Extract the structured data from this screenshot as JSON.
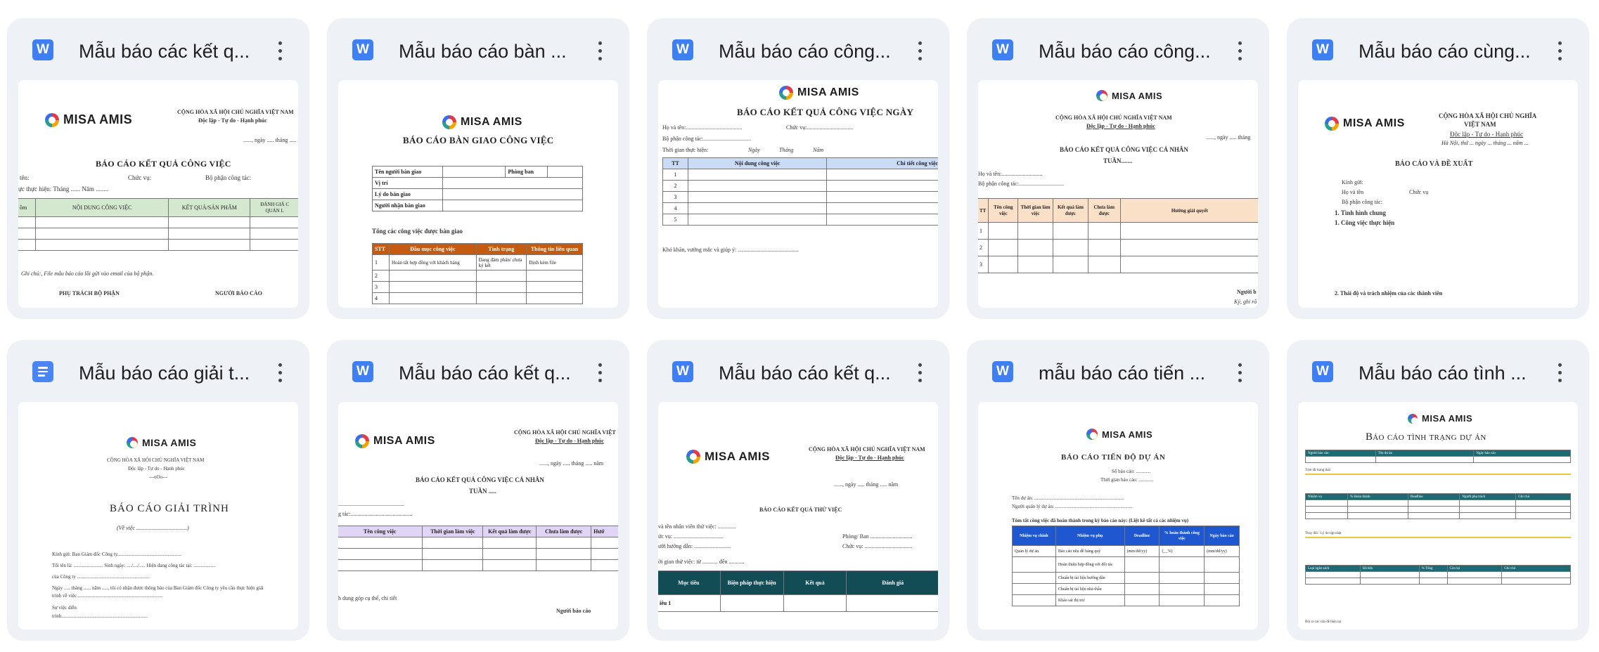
{
  "cards": [
    {
      "title": "Mẫu báo các kết q...",
      "icon": "word-icon",
      "thumb": {
        "logo": "MISA AMIS",
        "header_right": [
          "CỘNG HÒA XÃ HỘI CHỦ NGHĨA VIỆT NAM",
          "Độc lập - Tự do - Hạnh phúc",
          "......, ngày ..... tháng ..... nă"
        ],
        "heading": "BÁO CÁO KẾT QUẢ CÔNG VIỆC",
        "fields": [
          "tên:",
          "Chức vụ:",
          "Bộ phận công tác:",
          "ực thực hiện: Tháng ...... Năm ........"
        ],
        "columns": [
          "ồm",
          "NỘI DUNG CÔNG VIỆC",
          "KẾT QUẢ/SẢN PHẨM",
          "ĐÁNH GIÁ C QUẢN L"
        ],
        "note": "Ghi chú:, File mẫu báo cáo lồi gửi vào email của bộ phận.",
        "footer": [
          "PHỤ TRÁCH BỘ PHẬN",
          "NGƯỜI BÁO CÁO"
        ]
      }
    },
    {
      "title": "Mẫu báo cáo bàn ...",
      "icon": "word-icon",
      "thumb": {
        "logo": "MISA AMIS",
        "heading": "BÁO CÁO BÀN GIAO CÔNG VIỆC",
        "form": [
          "Tên người bàn giao",
          "Phòng ban",
          "Vị trí",
          "Lý do bàn giao",
          "Người nhận bàn giao"
        ],
        "subheading": "Tổng các công việc được bàn giao",
        "columns": [
          "STT",
          "Đầu mục công việc",
          "Tình trạng",
          "Thông tin liên quan"
        ],
        "row1": [
          "1",
          "Hoàn tất hợp đồng với khách hàng",
          "Đang đàm phán/ chưa ký kết",
          "Định kèm file"
        ],
        "row_numbers": [
          "2",
          "3",
          "4"
        ]
      }
    },
    {
      "title": "Mẫu báo cáo công...",
      "icon": "word-icon",
      "thumb": {
        "logo": "MISA AMIS",
        "heading": "BÁO CÁO KẾT QUẢ CÔNG VIỆC NGÀY",
        "fields": [
          "Họ và tên:........................................",
          "Chức vụ:.................................",
          "Bộ phận công tác:..................................",
          "Thời gian thực hiện:",
          "Ngày",
          "Tháng",
          "Năm"
        ],
        "columns": [
          "TT",
          "Nội dung công việc",
          "Chi tiết công việc"
        ],
        "rows": [
          "1",
          "2",
          "3",
          "4",
          "5"
        ],
        "note": "Khó khăn, vướng mắc và giúp ý: ..........................................."
      }
    },
    {
      "title": "Mẫu báo cáo công...",
      "icon": "word-icon",
      "thumb": {
        "logo": "MISA AMIS",
        "header": [
          "CỘNG HÒA XÃ HỘI CHỦ NGHĨA VIỆT NAM",
          "Độc lập - Tự do - Hạnh phúc"
        ],
        "date": "......, ngày ..... tháng",
        "heading": "BÁO CÁO KẾT QUẢ CÔNG VIỆC CÁ NHÂN",
        "sub": "TUẦN.......",
        "fields": [
          "Họ và tên:.............................",
          "Bộ phận công tác:................................"
        ],
        "columns": [
          "TT",
          "Tên công việc",
          "Thời gian làm việc",
          "Kết quả làm được",
          "Chưa làm được",
          "Hướng giải quyết"
        ],
        "rows": [
          "1",
          "2",
          "3"
        ],
        "footer": [
          "Người b",
          "Ký, ghi rõ"
        ]
      }
    },
    {
      "title": "Mẫu báo cáo cùng...",
      "icon": "word-icon",
      "thumb": {
        "logo": "MISA AMIS",
        "header_right": [
          "CỘNG HÒA XÃ HỘI CHỦ NGHĨA",
          "VIỆT NAM",
          "Độc lập - Tự do - Hạnh phúc",
          "Hà Nội, thứ ... ngày ... tháng ... năm ..."
        ],
        "heading": "BÁO CÁO VÀ ĐỀ XUẤT",
        "fields": [
          "Kính gửi:",
          "Họ và tên",
          "Chức vụ",
          "Bộ phận công tác:"
        ],
        "items": [
          "1. Tình hình chung",
          "1. Công việc thực hiện",
          "2. Thái độ và trách nhiệm của các thành viên"
        ]
      }
    },
    {
      "title": "Mẫu báo cáo giải t...",
      "icon": "docs-icon",
      "thumb": {
        "logo": "MISA AMIS",
        "header": [
          "CỘNG HÒA XÃ HỘI CHỦ NGHĨA VIỆT NAM",
          "Độc lập - Tự do - Hạnh phúc",
          "---oOo---"
        ],
        "heading": "BÁO CÁO GIẢI TRÌNH",
        "sub": "(Về việc ....................................)",
        "lines": [
          "Kính gửi: Ban Giám đốc Công ty....................................................",
          "Tôi tên là: ........................ Sinh ngày: ..../..../..... Hiện đang công tác tại: ..................",
          "của Công ty ...........................................................",
          "Ngày ..... tháng ...... năm ...... tôi có nhận được thông báo của Ban Giám đốc Công ty yêu cầu thực hiện giải",
          "trình về việc......................................................................",
          "Sự việc diễn",
          "trình......................................................................"
        ]
      }
    },
    {
      "title": "Mẫu báo cáo kết q...",
      "icon": "word-icon",
      "thumb": {
        "logo": "MISA AMIS",
        "header_right": [
          "CỘNG HÒA XÃ HỘI CHỦ NGHĨA VIỆT",
          "Độc lập - Tự do - Hạnh phúc"
        ],
        "date": "......, ngày ..... tháng ..... năm",
        "heading": "BÁO CÁO KẾT QUẢ CÔNG VIỆC CÁ NHÂN",
        "sub": "TUẦN .....",
        "fields": [
          "...............................................",
          "g tác:............................................"
        ],
        "columns": [
          "Tên công việc",
          "Thời gian làm việc",
          "Kết quả làm được",
          "Chưa làm được",
          "Hướ"
        ],
        "note": "h dung góp cụ thể, chi tiết",
        "footer": "Người báo cáo"
      }
    },
    {
      "title": "Mẫu báo cáo kết q...",
      "icon": "word-icon",
      "thumb": {
        "logo": "MISA AMIS",
        "header_right": [
          "CỘNG HÒA XÃ HỘI CHỦ NGHĨA VIỆT NAM",
          "Độc lập - Tự do - Hạnh phúc"
        ],
        "date": "......, ngày ..... tháng ..... năm",
        "heading": "BÁO CÁO KẾT QUẢ THỬ VIỆC",
        "fields": [
          "và tên nhân viên thử việc: .............",
          "ức vụ: ...................................",
          "ười hướng dẫn: ..........................",
          "Phòng/ Ban ..............................",
          "Chức vụ: ..................................",
          "ời gian thử việc: từ ........... đến ..........."
        ],
        "columns": [
          "Mục tiêu",
          "Biện pháp thực hiện",
          "Kết quả",
          "Đánh giá"
        ],
        "row": "iêu 1"
      }
    },
    {
      "title": "mẫu báo cáo tiến ...",
      "icon": "word-icon",
      "thumb": {
        "logo": "MISA AMIS",
        "heading": "BÁO CÁO TIẾN ĐỘ DỰ ÁN",
        "meta": [
          "Số báo cáo: ............",
          "Thời gian báo cáo: ............"
        ],
        "fields": [
          "Tên dự án: .........................................................................",
          "Người quản lý dự án: ..............................................................."
        ],
        "subheading": "Tóm tắt công việc đã hoàn thành trong kỳ báo cáo này: (Liệt kê tất cả các nhiệm vụ)",
        "columns": [
          "Nhiệm vụ chính",
          "Nhiệm vụ phụ",
          "Deadline",
          "% hoàn thành công việc",
          "Ngày báo cáo"
        ],
        "rows": [
          [
            "Quản lý dự án",
            "Báo cáo nêu đề hàng quý",
            "(mm/dd/yy)",
            "(__%)",
            "(mm/dd/yy)"
          ],
          [
            "",
            "Hoàn thiện hợp đồng với đối tác",
            "",
            "",
            ""
          ],
          [
            "",
            "Chuẩn bị tài liệu hướng dẫn",
            "",
            "",
            ""
          ],
          [
            "",
            "Chuẩn bị tài liệu nhà thầu",
            "",
            "",
            ""
          ],
          [
            "",
            "Khảo sát thị trư",
            "",
            "",
            ""
          ]
        ]
      }
    },
    {
      "title": "Mẫu báo cáo tình ...",
      "icon": "word-icon",
      "thumb": {
        "logo": "MISA AMIS",
        "heading": "Báo cáo tình trạng dự án",
        "table1": [
          "Người báo cáo",
          "Tên dự án",
          "Ngày báo cáo"
        ],
        "section1": "Tóm tắt trạng thái",
        "table2": [
          "Nhiệm vụ",
          "% Hoàn thành",
          "Deadline",
          "Người phụ trách",
          "Ghi chú"
        ],
        "section2": "Thay đổi / Lý do cập nhật",
        "table3": [
          "Loại ngân sách",
          "Đã tiêu",
          "% Tổng",
          "Còn lại",
          "Ghi chú"
        ],
        "footer": "Rủi ro các vấn đề hiện tại"
      }
    }
  ],
  "colors": {
    "card_bg": "#eef1f6",
    "word_blue": "#3f7ff4",
    "docs_blue": "#4a86f3",
    "table_green": "#d4e8d0",
    "table_orange": "#c55a11",
    "table_blue_light": "#c9dbf5",
    "table_peach": "#fbe0c8",
    "table_purple": "#e1d5f5",
    "table_teal_dark": "#124d56",
    "table_blue_dark": "#1f57d1",
    "table_teal": "#1e6a72"
  }
}
